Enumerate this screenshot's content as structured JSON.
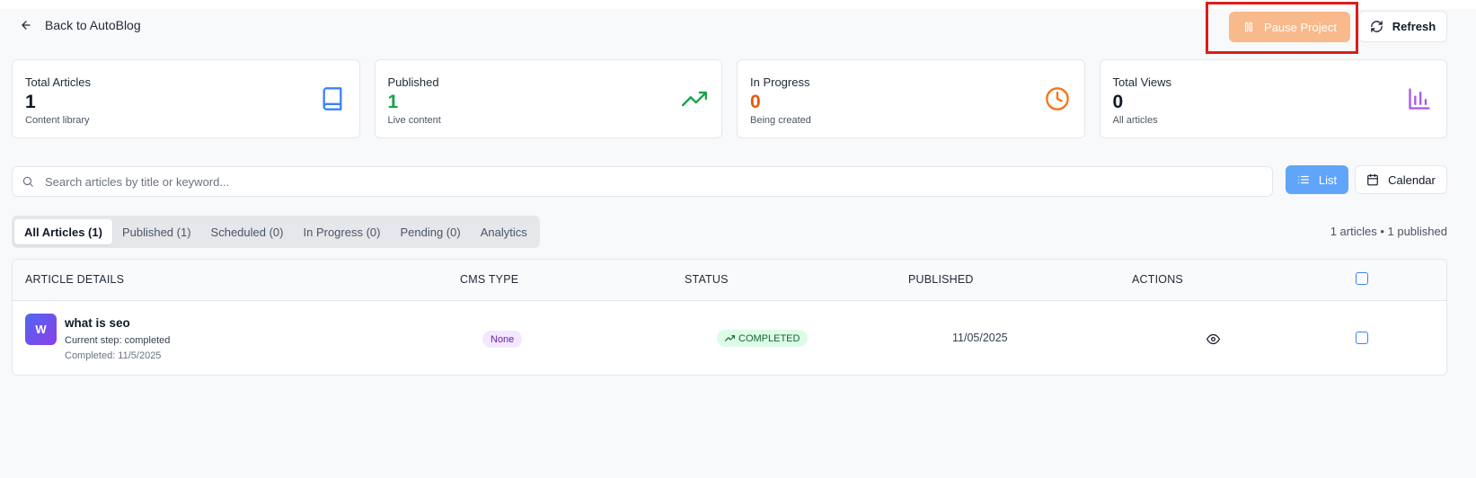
{
  "header": {
    "back_label": "Back to AutoBlog",
    "pause_label": "Pause Project",
    "refresh_label": "Refresh"
  },
  "stats": [
    {
      "title": "Total Articles",
      "value": "1",
      "subtitle": "Content library",
      "icon": "book-icon",
      "color": "#3b82f6"
    },
    {
      "title": "Published",
      "value": "1",
      "subtitle": "Live content",
      "icon": "trending-up-icon",
      "color": "#16a34a"
    },
    {
      "title": "In Progress",
      "value": "0",
      "subtitle": "Being created",
      "icon": "clock-icon",
      "color": "#f97316"
    },
    {
      "title": "Total Views",
      "value": "0",
      "subtitle": "All articles",
      "icon": "bar-chart-icon",
      "color": "#a855f7"
    }
  ],
  "search": {
    "placeholder": "Search articles by title or keyword...",
    "value": ""
  },
  "view_toggle": {
    "list_label": "List",
    "calendar_label": "Calendar",
    "active": "List"
  },
  "tabs": [
    {
      "label": "All Articles (1)",
      "active": true
    },
    {
      "label": "Published (1)",
      "active": false
    },
    {
      "label": "Scheduled (0)",
      "active": false
    },
    {
      "label": "In Progress (0)",
      "active": false
    },
    {
      "label": "Pending (0)",
      "active": false
    },
    {
      "label": "Analytics",
      "active": false
    }
  ],
  "summary": "1 articles • 1 published",
  "table": {
    "columns": [
      "ARTICLE DETAILS",
      "CMS TYPE",
      "STATUS",
      "PUBLISHED",
      "ACTIONS"
    ],
    "rows": [
      {
        "avatar": "W",
        "title": "what is seo",
        "step": "Current step: completed",
        "completed": "Completed: 11/5/2025",
        "cms": "None",
        "status": "COMPLETED",
        "published": "11/05/2025"
      }
    ]
  },
  "colors": {
    "pause_button": "#f8b98c",
    "list_button": "#60a5fa",
    "highlight_box": "#dc1c1c"
  }
}
